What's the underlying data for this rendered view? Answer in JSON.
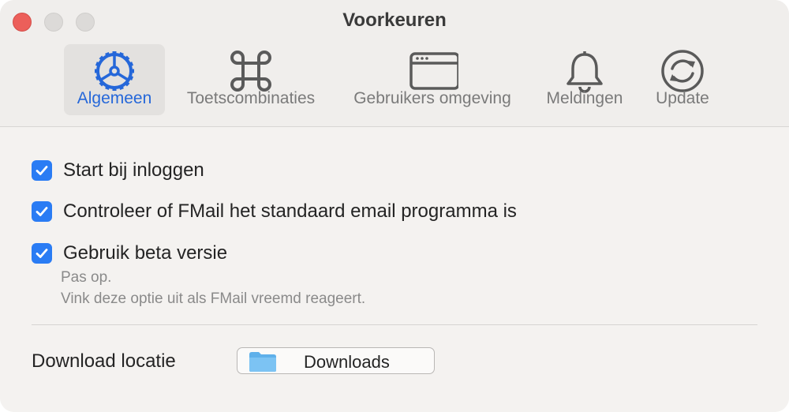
{
  "window": {
    "title": "Voorkeuren"
  },
  "tabs": [
    {
      "label": "Algemeen",
      "icon": "gear-icon",
      "active": true
    },
    {
      "label": "Toetscombinaties",
      "icon": "command-key-icon",
      "active": false
    },
    {
      "label": "Gebruikers omgeving",
      "icon": "window-icon",
      "active": false
    },
    {
      "label": "Meldingen",
      "icon": "bell-icon",
      "active": false
    },
    {
      "label": "Update",
      "icon": "refresh-icon",
      "active": false
    }
  ],
  "options": [
    {
      "label": "Start bij inloggen",
      "checked": true
    },
    {
      "label": "Controleer of FMail het standaard email programma is",
      "checked": true
    },
    {
      "label": "Gebruik beta versie",
      "checked": true
    }
  ],
  "beta_hint": {
    "line1": "Pas op.",
    "line2": "Vink deze optie uit als FMail vreemd reageert."
  },
  "download": {
    "label": "Download locatie",
    "folder": "Downloads"
  },
  "colors": {
    "accent": "#2567d9",
    "checkbox": "#2a7cf4",
    "close": "#ec5f5a"
  }
}
